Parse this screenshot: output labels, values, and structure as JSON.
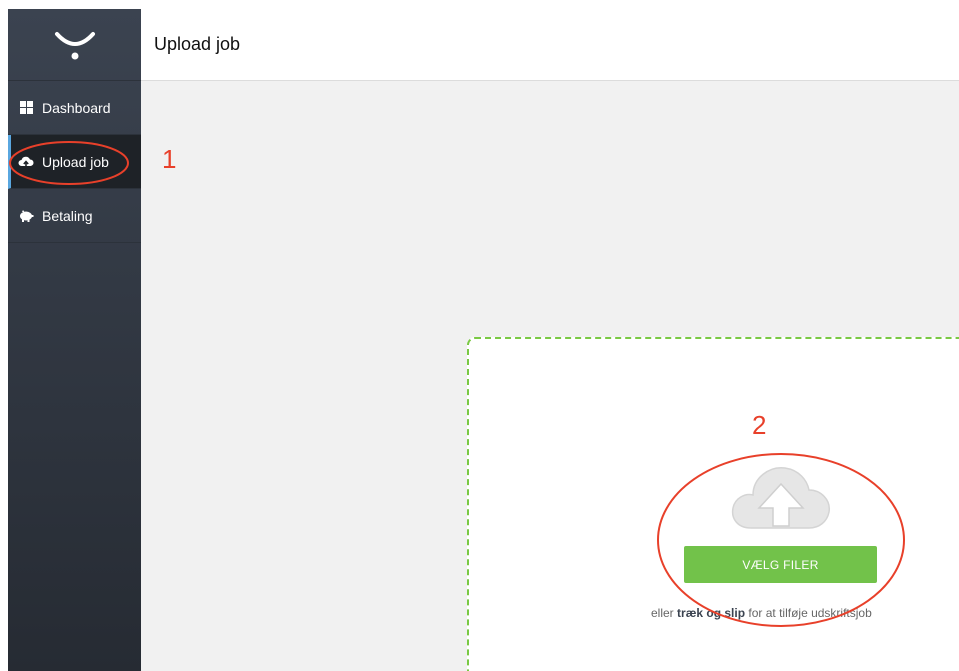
{
  "header": {
    "title": "Upload job"
  },
  "sidebar": {
    "items": [
      {
        "label": "Dashboard",
        "icon": "grid-icon",
        "active": false
      },
      {
        "label": "Upload job",
        "icon": "upload-cloud-icon",
        "active": true
      },
      {
        "label": "Betaling",
        "icon": "piggy-bank-icon",
        "active": false
      }
    ]
  },
  "upload": {
    "button_label": "VÆLG FILER",
    "hint_prefix": "eller",
    "hint_bold": "træk og slip",
    "hint_suffix": "for at tilføje udskriftsjob"
  },
  "annotations": {
    "one": "1",
    "two": "2"
  },
  "colors": {
    "sidebar_bg": "#333a45",
    "accent_green": "#72c24a",
    "dashed_border": "#7ac943",
    "annotation_red": "#e8402a"
  }
}
